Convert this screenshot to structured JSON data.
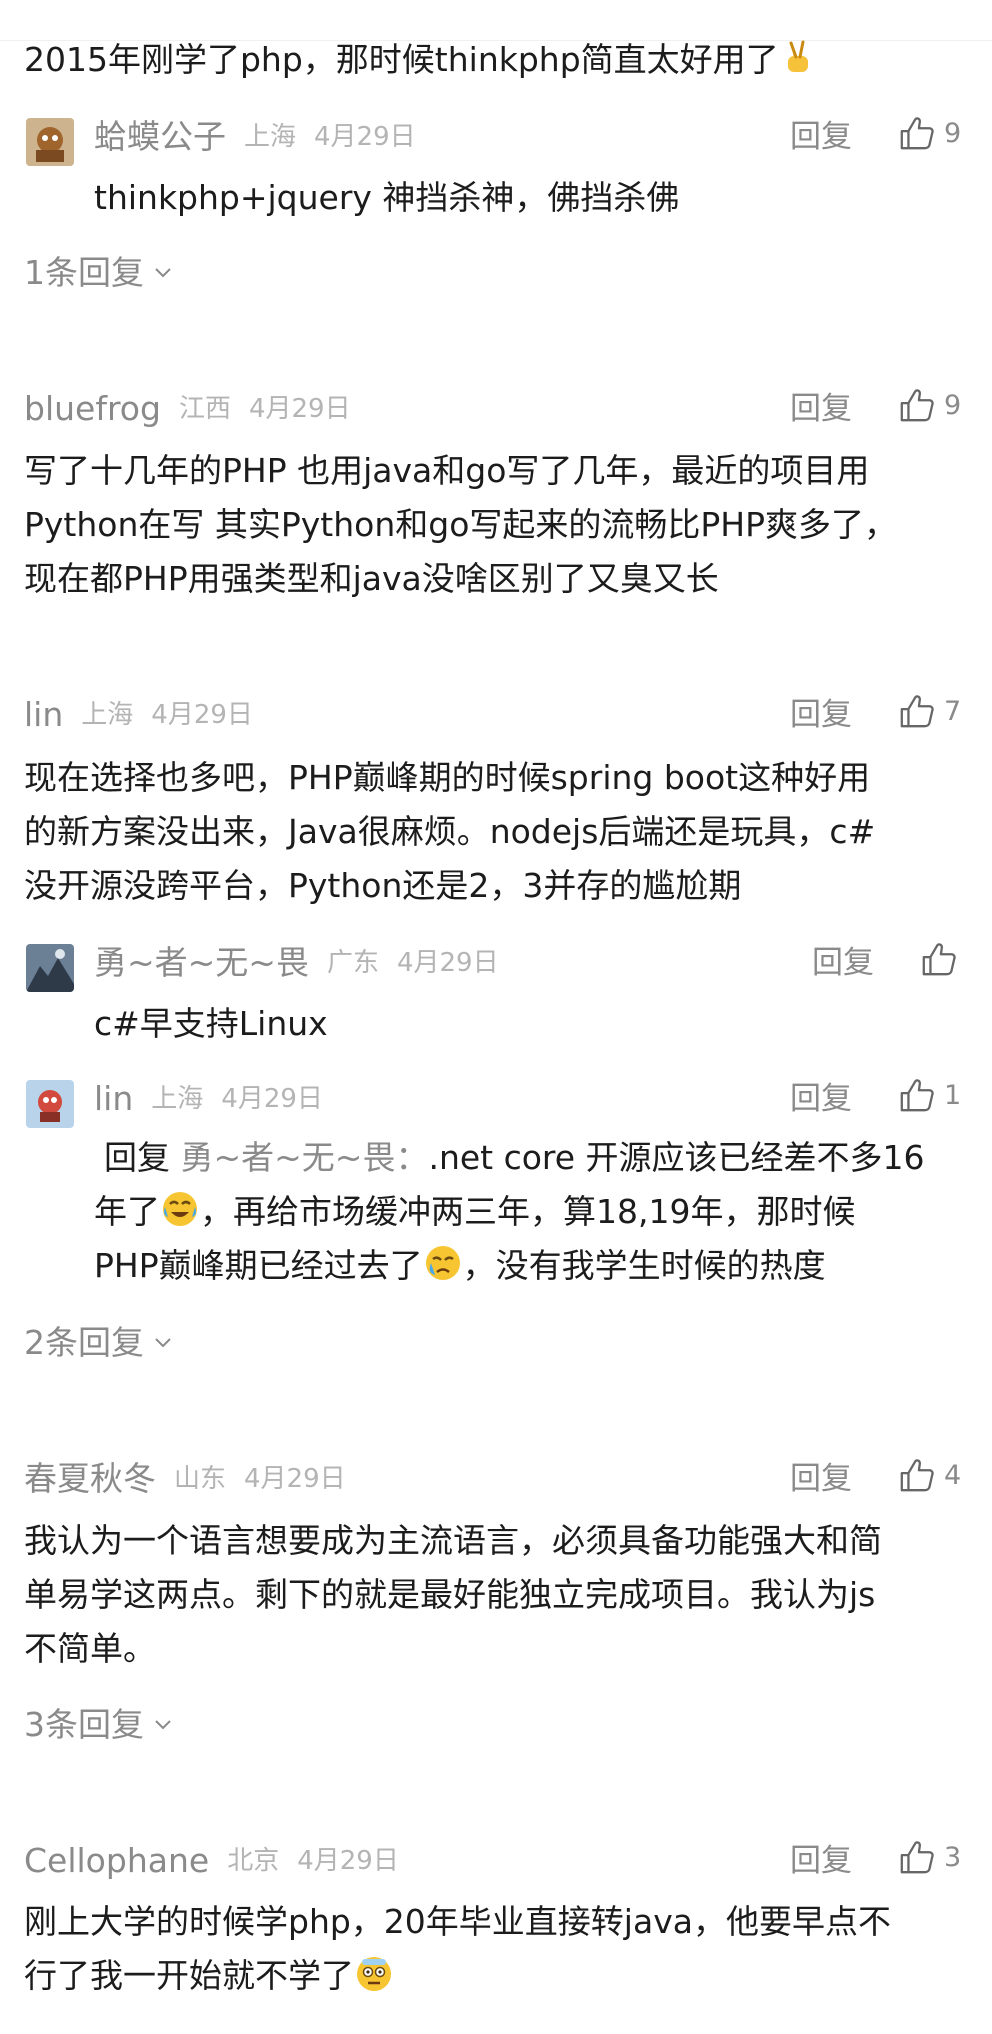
{
  "top_comment_tail": "2015年刚学了php，那时候thinkphp简直太好用了",
  "action_label": "回复",
  "threads": [
    {
      "replies": [
        {
          "name": "蛤蟆公子",
          "location": "上海",
          "date": "4月29日",
          "likes": "9",
          "text": "thinkphp+jquery 神挡杀神，佛挡杀佛"
        }
      ],
      "more_replies": "1条回复"
    },
    {
      "name": "bluefrog",
      "location": "江西",
      "date": "4月29日",
      "likes": "9",
      "lines": [
        "写了十几年的PHP 也用java和go写了几年，最近的项目用",
        "Python在写 其实Python和go写起来的流畅比PHP爽多了，",
        "现在都PHP用强类型和java没啥区别了又臭又长"
      ]
    },
    {
      "name": "lin",
      "location": "上海",
      "date": "4月29日",
      "likes": "7",
      "lines": [
        "现在选择也多吧，PHP巅峰期的时候spring boot这种好用",
        "的新方案没出来，Java很麻烦。nodejs后端还是玩具，c#",
        "没开源没跨平台，Python还是2，3并存的尴尬期"
      ],
      "replies": [
        {
          "name": "勇~者~无~畏",
          "location": "广东",
          "date": "4月29日",
          "likes": "",
          "text": "c#早支持Linux"
        },
        {
          "name": "lin",
          "location": "上海",
          "date": "4月29日",
          "likes": "1",
          "reply_prefix": "回复",
          "reply_to": "勇~者~无~畏：",
          "line1": ".net core 开源应该已经差不多16",
          "line2_a": "年了",
          "line2_b": "，再给市场缓冲两三年，算18,19年，那时候",
          "line3_a": "PHP巅峰期已经过去了",
          "line3_b": "，没有我学生时候的热度"
        }
      ],
      "more_replies": "2条回复"
    },
    {
      "name": "春夏秋冬",
      "location": "山东",
      "date": "4月29日",
      "likes": "4",
      "lines": [
        "我认为一个语言想要成为主流语言，必须具备功能强大和简",
        "单易学这两点。剩下的就是最好能独立完成项目。我认为js",
        "不简单。"
      ],
      "more_replies": "3条回复"
    },
    {
      "name": "Cellophane",
      "location": "北京",
      "date": "4月29日",
      "likes": "3",
      "lines": [
        "刚上大学的时候学php，20年毕业直接转java，他要早点不",
        "行了我一开始就不学了"
      ]
    }
  ]
}
